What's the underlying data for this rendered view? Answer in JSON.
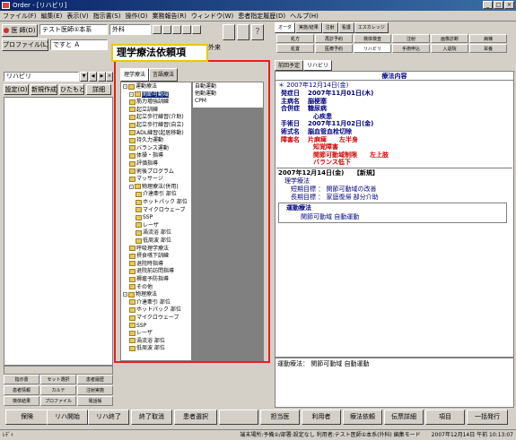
{
  "window": {
    "title": "Order - [リハビリ]"
  },
  "menu": [
    "ファイル(F)",
    "編集(E)",
    "表示(V)",
    "指示書(S)",
    "操作(O)",
    "業務報告(R)",
    "ウィンドウ(W)",
    "患者指定履歴(D)",
    "ヘルプ(H)"
  ],
  "header": {
    "doctor_label": "医 師(D)",
    "doctor_value": "テスト医師①本系",
    "dept_value": "外科",
    "profile_label": "プロファイル(L)",
    "profile_value": "ですと Ａ",
    "outpatient": "外来"
  },
  "order_tabs": [
    "オーダ",
    "実施/結果",
    "注射",
    "看護",
    "エスカレッジ"
  ],
  "order_grid": [
    "処方",
    "再診予約",
    "検体検査",
    "注射",
    "画像診断",
    "病棟",
    "処置",
    "医療予約",
    "リハビリ",
    "手術申込",
    "入退院",
    "栄養"
  ],
  "annotation": {
    "label": "理学療法依頼項"
  },
  "left": {
    "combo_value": "リハビリ",
    "buttons": [
      "設定(O)",
      "新規作成(R)",
      "ひたもと(T)",
      "詳細"
    ],
    "nav": [
      "指示書",
      "セット選択",
      "患者履歴",
      "患者情報",
      "カルテ",
      "注射実施",
      "検体結果",
      "プロファイル",
      "電話帳"
    ]
  },
  "tree_tabs": [
    "理学療法",
    "言語療法"
  ],
  "tree": [
    {
      "label": "運動療法",
      "level": 0,
      "expand": "-",
      "selected": false
    },
    {
      "label": "関節可動域",
      "level": 1,
      "expand": "-",
      "selected": true
    },
    {
      "label": "筋力増強訓練",
      "level": 1,
      "expand": "",
      "selected": false
    },
    {
      "label": "起立訓練",
      "level": 1,
      "expand": "",
      "selected": false
    },
    {
      "label": "起立歩行練習(介助)",
      "level": 1,
      "expand": "",
      "selected": false
    },
    {
      "label": "起立歩行練習(自立)",
      "level": 1,
      "expand": "",
      "selected": false
    },
    {
      "label": "ADL練習(起居移動)",
      "level": 1,
      "expand": "",
      "selected": false
    },
    {
      "label": "持久力運動",
      "level": 1,
      "expand": "",
      "selected": false
    },
    {
      "label": "バランス運動",
      "level": 1,
      "expand": "",
      "selected": false
    },
    {
      "label": "体操・指導",
      "level": 1,
      "expand": "",
      "selected": false
    },
    {
      "label": "評価指導",
      "level": 1,
      "expand": "",
      "selected": false
    },
    {
      "label": "術後プログラム",
      "level": 1,
      "expand": "",
      "selected": false
    },
    {
      "label": "マッサージ",
      "level": 1,
      "expand": "",
      "selected": false
    },
    {
      "label": "物理療法(併用)",
      "level": 1,
      "expand": "-",
      "selected": false
    },
    {
      "label": "介達牽引 部位",
      "level": 2,
      "expand": "",
      "selected": false
    },
    {
      "label": "ホットパック 部位",
      "level": 2,
      "expand": "",
      "selected": false
    },
    {
      "label": "マイクロウェーブ",
      "level": 2,
      "expand": "",
      "selected": false
    },
    {
      "label": "SSP",
      "level": 2,
      "expand": "",
      "selected": false
    },
    {
      "label": "レーザ",
      "level": 2,
      "expand": "",
      "selected": false
    },
    {
      "label": "渦流浴 部位",
      "level": 2,
      "expand": "",
      "selected": false
    },
    {
      "label": "低周波 部位",
      "level": 2,
      "expand": "",
      "selected": false
    },
    {
      "label": "呼吸理学療法",
      "level": 1,
      "expand": "",
      "selected": false
    },
    {
      "label": "摂食嚥下訓練",
      "level": 1,
      "expand": "",
      "selected": false
    },
    {
      "label": "退院時指導",
      "level": 1,
      "expand": "",
      "selected": false
    },
    {
      "label": "退院前訪問指導",
      "level": 1,
      "expand": "",
      "selected": false
    },
    {
      "label": "褥瘡予防指導",
      "level": 1,
      "expand": "",
      "selected": false
    },
    {
      "label": "その他",
      "level": 1,
      "expand": "",
      "selected": false
    },
    {
      "label": "物理療法",
      "level": 0,
      "expand": "-",
      "selected": false
    },
    {
      "label": "介達牽引 部位",
      "level": 1,
      "expand": "",
      "selected": false
    },
    {
      "label": "ホットパック 部位",
      "level": 1,
      "expand": "",
      "selected": false
    },
    {
      "label": "マイクロウェーブ",
      "level": 1,
      "expand": "",
      "selected": false
    },
    {
      "label": "SSP",
      "level": 1,
      "expand": "",
      "selected": false
    },
    {
      "label": "レーザ",
      "level": 1,
      "expand": "",
      "selected": false
    },
    {
      "label": "渦流浴 部位",
      "level": 1,
      "expand": "",
      "selected": false
    },
    {
      "label": "低周波 部位",
      "level": 1,
      "expand": "",
      "selected": false
    }
  ],
  "options": [
    {
      "label": "自動運動",
      "selected": false
    },
    {
      "label": "他動運動",
      "selected": false
    },
    {
      "label": "CPM",
      "selected": false
    }
  ],
  "doc_tabs": [
    "前回予定",
    "リハビリ"
  ],
  "doc": {
    "header": "療法内容",
    "date_line": "＊ 2007年12月14日(金)",
    "fields": [
      {
        "label": "発症日",
        "value": "2007年11月01日(木)",
        "indent": 0
      },
      {
        "label": "主病名",
        "value": "脳梗塞",
        "indent": 0
      },
      {
        "label": "合併症",
        "value": "糖尿病",
        "indent": 0
      },
      {
        "label": "",
        "value": "心疾患",
        "indent": 1
      },
      {
        "label": "手術日",
        "value": "2007年11月02日(金)",
        "indent": 0
      },
      {
        "label": "術式名",
        "value": "脳血管血栓切除",
        "indent": 0
      },
      {
        "label": "障害名",
        "value": "片麻痺　　左半身",
        "indent": 0,
        "red": true
      },
      {
        "label": "",
        "value": "知覚障害",
        "indent": 1,
        "red": true
      },
      {
        "label": "",
        "value": "関節可動域制限　　左上肢",
        "indent": 1,
        "red": true
      },
      {
        "label": "",
        "value": "バランス低下",
        "indent": 1,
        "red": true
      }
    ],
    "block_title": "2007年12月14日(金)　　【新規】",
    "block_lines": [
      "理学療法",
      "　短期目標 ： 関節可動域の改善",
      "　長期目標 ： 家庭復帰 部分介助"
    ],
    "section_label": "運動療法",
    "section_item": "関節可動域 自動運動",
    "footer_note": "運動療法： 関節可動域 自動運動"
  },
  "bottom_buttons": [
    "保険",
    "リハ開始",
    "リハ終了",
    "終了取消",
    "患者選択",
    "",
    "担当医",
    "利用者",
    "療法依頼",
    "伝票詳細",
    "項目",
    "一括発行"
  ],
  "status": {
    "left": "ﾚﾃﾞｨ",
    "right": "端末場所:予備①/部署:設定なし 利用者:テスト医師①本系(外科) 編集モード　　2007年12月14日 午前 10:13:07"
  },
  "colors": {
    "annotation_border": "#e8201b",
    "accent_red": "#cc0000",
    "navy": "#000080",
    "title_bar": "#0a246a"
  }
}
